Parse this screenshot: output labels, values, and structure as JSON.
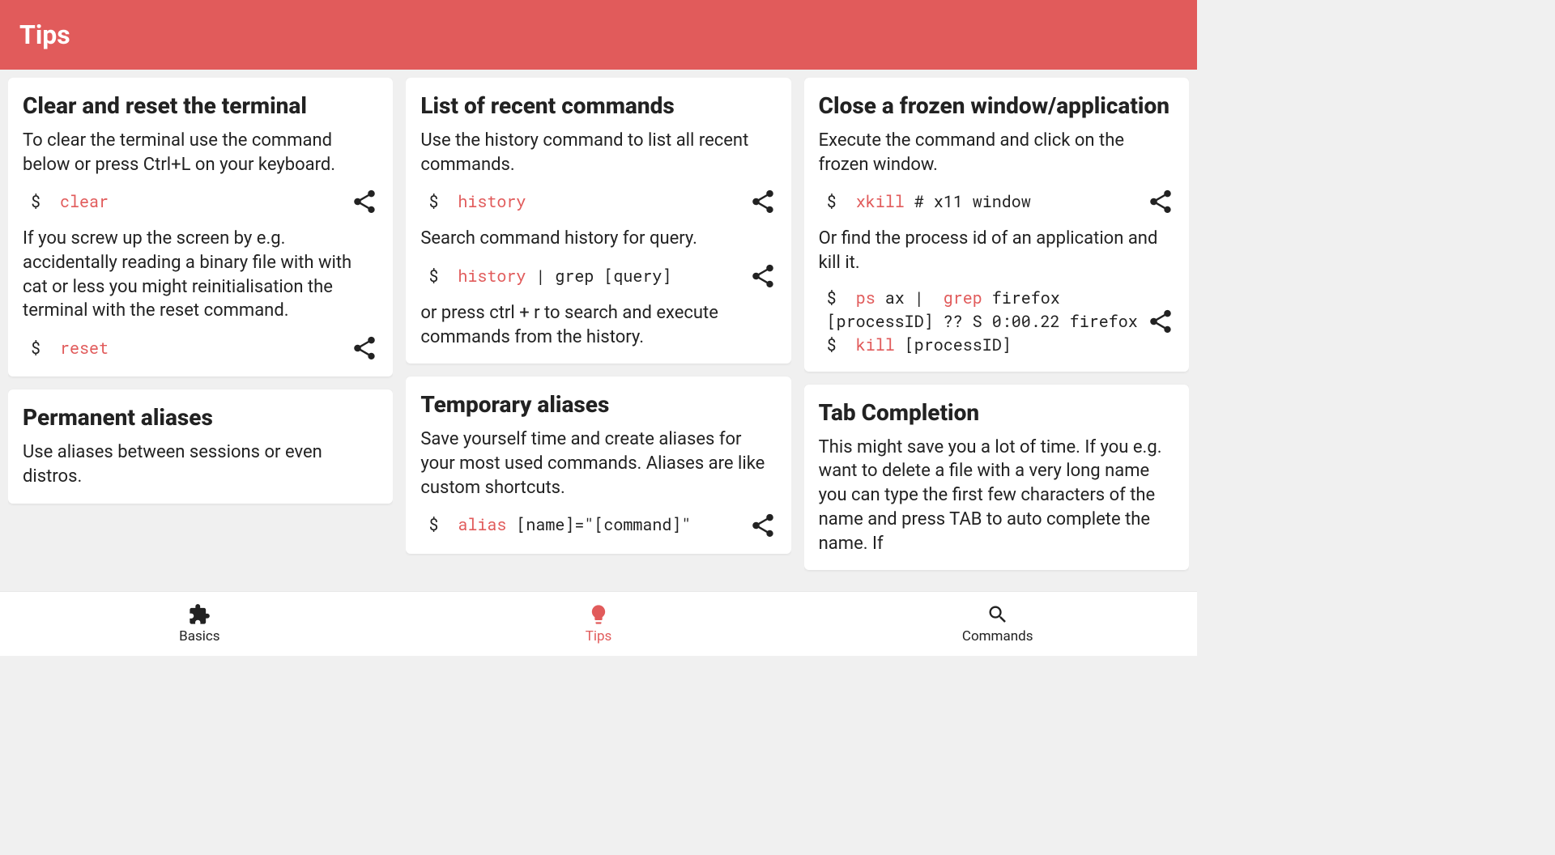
{
  "header": {
    "title": "Tips"
  },
  "colors": {
    "accent": "#e15b5b"
  },
  "cards": {
    "clear": {
      "title": "Clear and reset the terminal",
      "text1": "To clear the terminal use the command below or press Ctrl+L on your keyboard.",
      "code1_prompt": "$ ",
      "code1_cmd": "clear",
      "text2": "If you screw up the screen by e.g. accidentally reading a binary file with with cat or less you might reinitialisation the terminal with the reset command.",
      "code2_prompt": "$ ",
      "code2_cmd": "reset"
    },
    "permalias": {
      "title": "Permanent aliases",
      "text1": "Use aliases between sessions or even distros."
    },
    "history": {
      "title": "List of recent commands",
      "text1": "Use the history command to list all recent commands.",
      "code1_prompt": "$ ",
      "code1_cmd": "history",
      "text2": "Search command history for query.",
      "code2_prompt": "$ ",
      "code2_cmd": "history",
      "code2_rest": " | grep [query]",
      "text3": "or press ctrl + r to search and execute commands from the history."
    },
    "tempalias": {
      "title": "Temporary aliases",
      "text1": "Save yourself time and create aliases for your most used commands. Aliases are like custom shortcuts.",
      "code1_prompt": "$ ",
      "code1_cmd": "alias",
      "code1_rest": " [name]=\"[command]\""
    },
    "frozen": {
      "title": "Close a frozen window/application",
      "text1": "Execute the command and click on the frozen window.",
      "code1_prompt": "$ ",
      "code1_cmd": "xkill",
      "code1_rest": " # x11 window",
      "text2": "Or find the process id of an application and kill it.",
      "code2_line1_p": "$ ",
      "code2_line1_c1": "ps",
      "code2_line1_r1": " ax | ",
      "code2_line1_c2": "grep",
      "code2_line1_r2": " firefox",
      "code2_line2": "[processID] ?? S 0:00.22 firefox",
      "code2_line3_p": "$ ",
      "code2_line3_c": "kill",
      "code2_line3_r": " [processID]"
    },
    "tab": {
      "title": "Tab Completion",
      "text1": "This might save you a lot of time. If you e.g. want to delete a file with a very long name you can type the first few characters of the name and press TAB to auto complete the name. If"
    }
  },
  "nav": {
    "basics": "Basics",
    "tips": "Tips",
    "commands": "Commands"
  }
}
